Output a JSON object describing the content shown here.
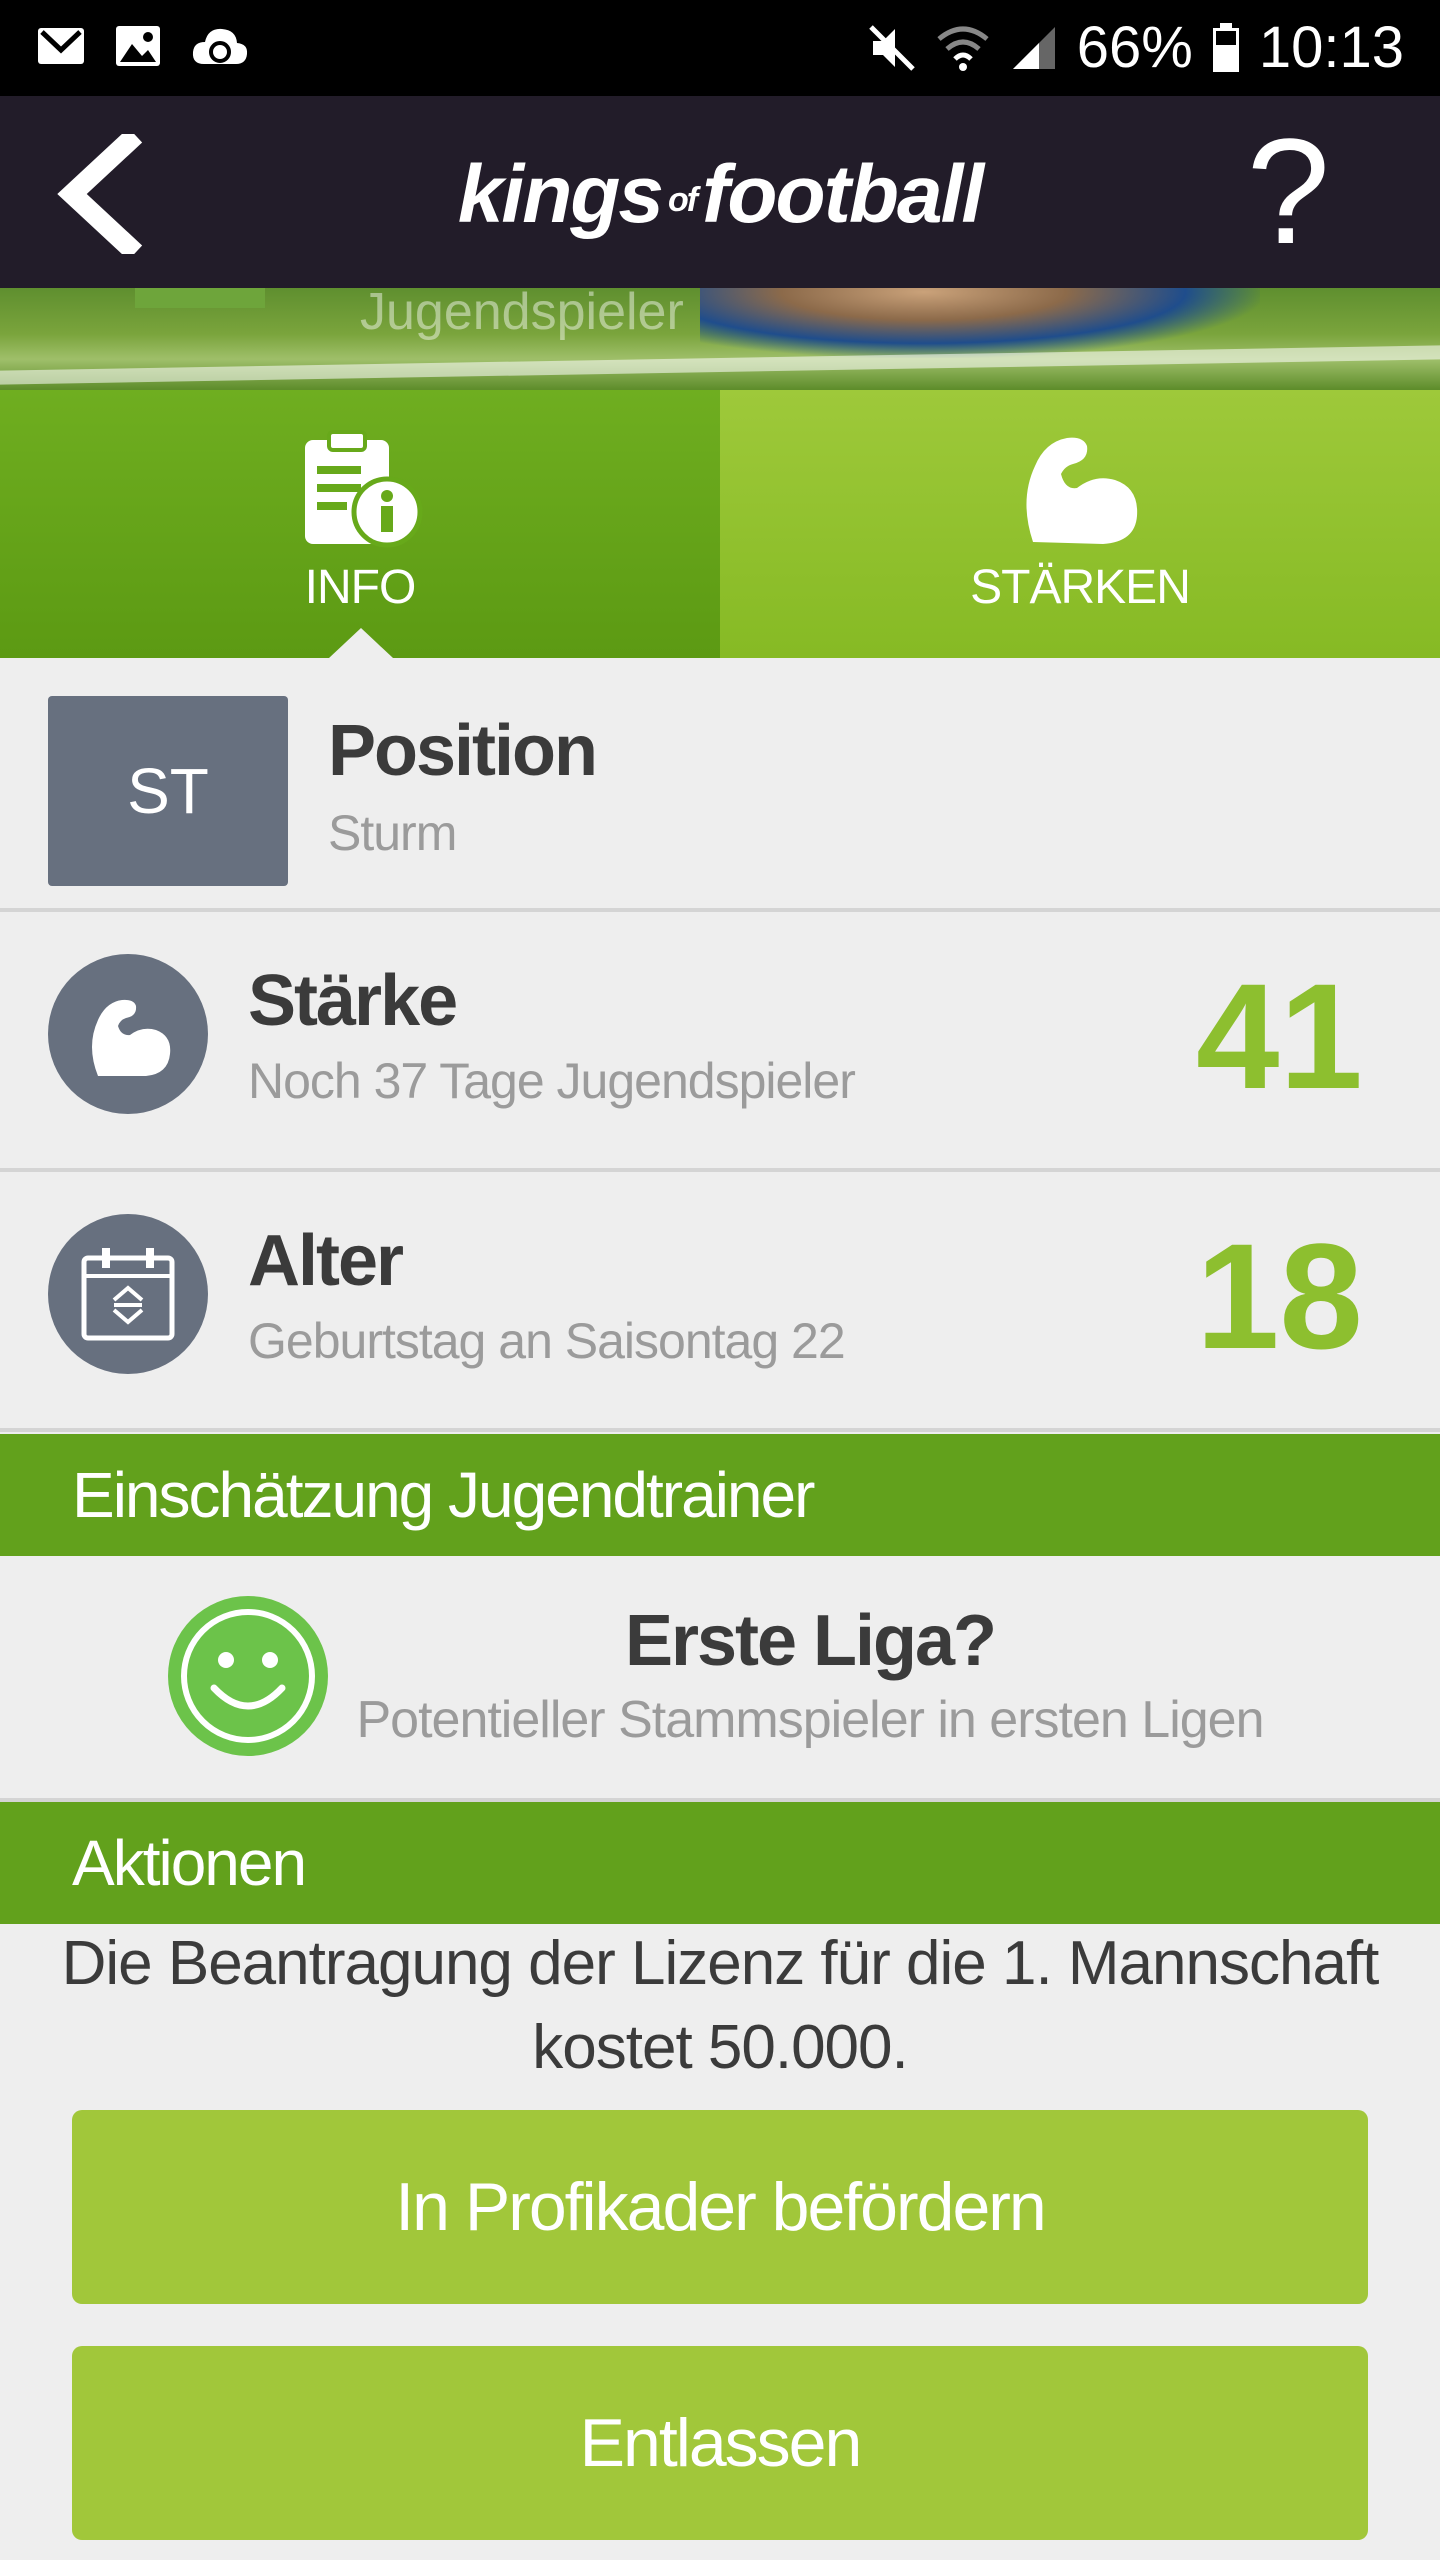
{
  "status_bar": {
    "battery": "66%",
    "time": "10:13",
    "icons": [
      "mail-icon",
      "image-icon",
      "cloud-sync-icon",
      "mute-icon",
      "wifi-icon",
      "signal-icon",
      "battery-icon"
    ]
  },
  "header": {
    "logo_main_1": "kings",
    "logo_of": "of",
    "logo_main_2": "football",
    "help": "?",
    "colors": {
      "background": "#221c29"
    }
  },
  "banner": {
    "text": "Jugendspieler"
  },
  "tabs": [
    {
      "label": "INFO",
      "icon": "info-clipboard-icon",
      "active": true
    },
    {
      "label": "STÄRKEN",
      "icon": "bicep-icon",
      "active": false
    }
  ],
  "position": {
    "badge": "ST",
    "title": "Position",
    "subtitle": "Sturm"
  },
  "strength": {
    "title": "Stärke",
    "subtitle": "Noch 37 Tage Jugendspieler",
    "value": "41",
    "icon": "bicep-icon"
  },
  "age": {
    "title": "Alter",
    "subtitle": "Geburtstag an Saisontag 22",
    "value": "18",
    "icon": "calendar-icon"
  },
  "assessment": {
    "header": "Einschätzung Jugendtrainer",
    "title": "Erste Liga?",
    "subtitle": "Potentieller Stammspieler in ersten Ligen",
    "icon": "smiley-icon"
  },
  "actions": {
    "header": "Aktionen",
    "license_text": "Die Beantragung der Lizenz für die 1. Mannschaft kostet 50.000.",
    "promote_label": "In Profikader befördern",
    "dismiss_label": "Entlassen"
  },
  "colors": {
    "accent_green": "#62a11c",
    "light_green": "#a1c73a",
    "value_green": "#8dbf2f",
    "slate": "#67707f"
  }
}
